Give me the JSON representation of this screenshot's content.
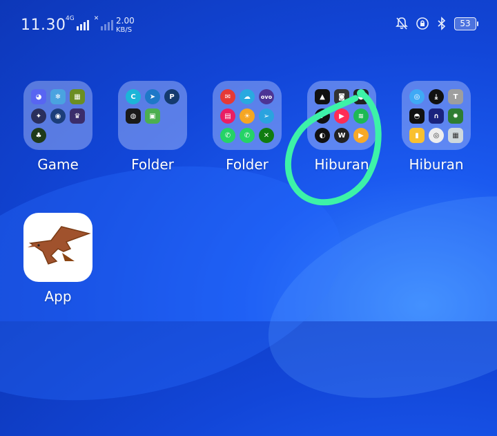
{
  "status_bar": {
    "time": "11.30",
    "network_type": "4G",
    "speed_value": "2.00",
    "speed_unit": "KB/S",
    "battery": "53",
    "icons": [
      "mute-bell-icon",
      "rotation-lock-icon",
      "bluetooth-icon",
      "battery-icon"
    ]
  },
  "folders": [
    {
      "label": "Game",
      "icons": [
        "discord-icon",
        "ice-age-icon",
        "minecraft-icon",
        "game-icon",
        "game-icon",
        "game-icon",
        "game-icon"
      ]
    },
    {
      "label": "Folder",
      "icons": [
        "canva-icon",
        "app-icon",
        "picsart-icon",
        "app-icon",
        "app-icon"
      ]
    },
    {
      "label": "Folder",
      "icons": [
        "app-icon",
        "app-icon",
        "ovo-icon",
        "app-icon",
        "weather-icon",
        "telegram-icon",
        "whatsapp-icon",
        "whatsapp-icon",
        "xbox-icon"
      ]
    },
    {
      "label": "Hiburan",
      "icons": [
        "app-icon",
        "app-icon",
        "app-icon",
        "app-icon",
        "music-icon",
        "spotify-icon",
        "app-icon",
        "app-icon",
        "app-icon"
      ]
    },
    {
      "label": "Hiburan",
      "icons": [
        "app-icon",
        "download-icon",
        "app-icon",
        "github-icon",
        "headphones-icon",
        "gear-icon",
        "app-icon",
        "fingerprint-icon",
        "app-icon"
      ]
    }
  ],
  "app": {
    "label": "App",
    "icon": "pterodactyl-icon"
  },
  "annotation": {
    "color": "#3df2a8"
  }
}
